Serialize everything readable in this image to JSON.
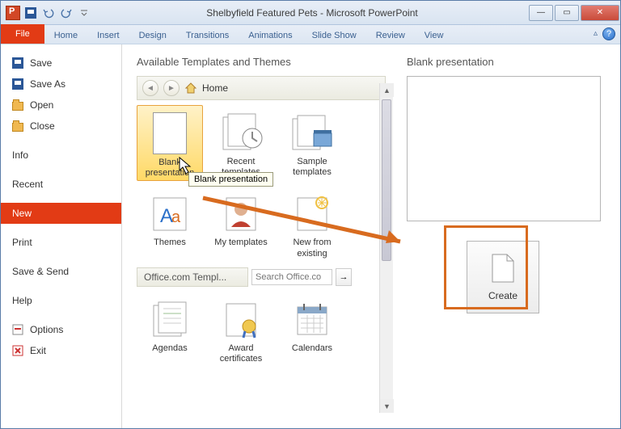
{
  "title": "Shelbyfield Featured Pets - Microsoft PowerPoint",
  "ribbon": {
    "file": "File",
    "tabs": [
      "Home",
      "Insert",
      "Design",
      "Transitions",
      "Animations",
      "Slide Show",
      "Review",
      "View"
    ]
  },
  "sidebar": {
    "items": [
      {
        "label": "Save",
        "icon": "save"
      },
      {
        "label": "Save As",
        "icon": "save"
      },
      {
        "label": "Open",
        "icon": "folder"
      },
      {
        "label": "Close",
        "icon": "folder"
      }
    ],
    "nav": [
      "Info",
      "Recent",
      "New",
      "Print",
      "Save & Send",
      "Help"
    ],
    "selected": "New",
    "footer": [
      {
        "label": "Options",
        "icon": "options"
      },
      {
        "label": "Exit",
        "icon": "exit"
      }
    ]
  },
  "templates": {
    "heading": "Available Templates and Themes",
    "breadcrumb_home": "Home",
    "items": [
      {
        "label": "Blank presentation",
        "selected": true
      },
      {
        "label": "Recent templates"
      },
      {
        "label": "Sample templates"
      },
      {
        "label": "Themes"
      },
      {
        "label": "My templates"
      },
      {
        "label": "New from existing"
      }
    ],
    "office_label": "Office.com Templ...",
    "search_placeholder": "Search Office.co",
    "row2": [
      "Agendas",
      "Award certificates",
      "Calendars"
    ]
  },
  "tooltip": "Blank presentation",
  "preview": {
    "heading": "Blank presentation",
    "create": "Create"
  }
}
